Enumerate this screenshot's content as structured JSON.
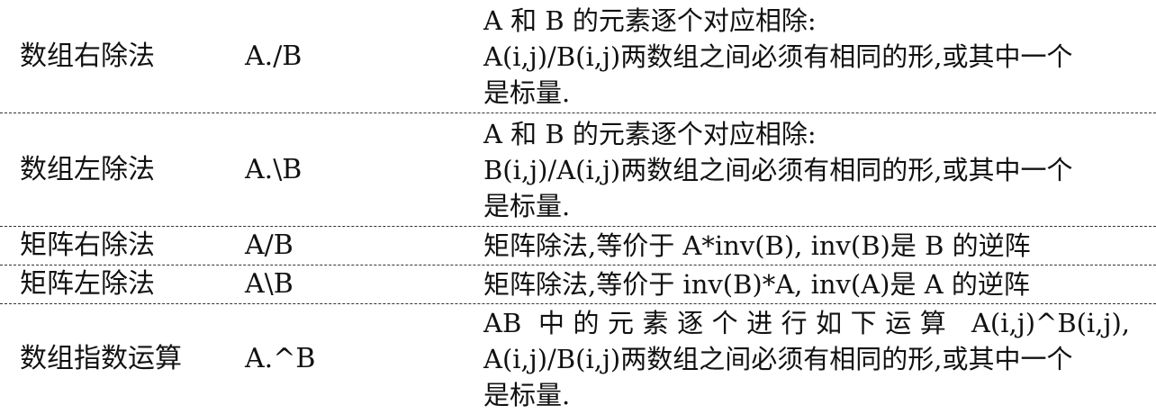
{
  "rows": [
    {
      "name": "数组右除法",
      "symbol": "A./B",
      "desc_lines": [
        "A 和 B 的元素逐个对应相除:",
        "A(i,j)/B(i,j)两数组之间必须有相同的形,或其中一个",
        "是标量."
      ]
    },
    {
      "name": "数组左除法",
      "symbol": "A.\\B",
      "desc_lines": [
        "A 和 B 的元素逐个对应相除:",
        "B(i,j)/A(i,j)两数组之间必须有相同的形,或其中一个",
        "是标量."
      ]
    },
    {
      "name": "矩阵右除法",
      "symbol": "A/B",
      "desc_lines": [
        "矩阵除法,等价于 A*inv(B), inv(B)是 B 的逆阵"
      ]
    },
    {
      "name": "矩阵左除法",
      "symbol": "A\\B",
      "desc_lines": [
        "矩阵除法,等价于 inv(B)*A, inv(A)是 A 的逆阵"
      ]
    },
    {
      "name": "数组指数运算",
      "symbol": "A.^B",
      "desc_lines": [
        "AB 中的元素逐个进行如下运算 A(i,j)^B(i,j),",
        "A(i,j)/B(i,j)两数组之间必须有相同的形,或其中一个",
        "是标量."
      ]
    }
  ]
}
